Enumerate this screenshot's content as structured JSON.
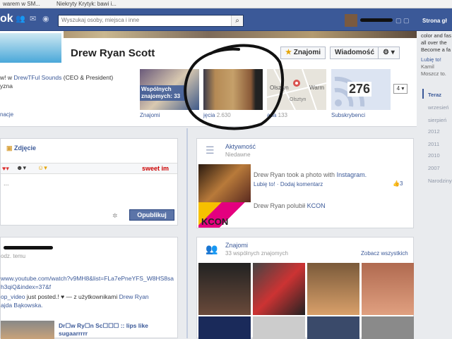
{
  "browser": {
    "tabs": [
      "warem w SM...",
      "Niekryty Krytyk: bawi i..."
    ]
  },
  "topbar": {
    "logo": "ok",
    "search_placeholder": "Wyszukaj osoby, miejsca i inne",
    "page_link": "Strona gł"
  },
  "profile": {
    "name": "Drew Ryan Scott",
    "btn_friends": "Znajomi",
    "btn_message": "Wiadomość",
    "btn_settings": "⚙ ▾",
    "info_line1_prefix": "w! w",
    "info_line1_link": "DrewTFul Sounds",
    "info_line1_suffix": "(CEO & President)",
    "info_line2": "yzna",
    "info_link": "nacje"
  },
  "tiles": {
    "common_friends": "Wspólnych znajomych: 33",
    "friends_label": "Znajomi",
    "photos_label": "jęcia",
    "photos_count": "2.630",
    "map_label": "apa",
    "map_count": "133",
    "map_city_left": "Olsztyn",
    "map_city_right": "Warm",
    "map_city_bottom": "Olsztyn",
    "subs_count": "276",
    "subs_label": "Subskrybenci",
    "more_count": "4"
  },
  "composer": {
    "photo_tab": "Zdjęcie",
    "placeholder": "...",
    "sweet": "sweet im",
    "publish": "Opublikuj"
  },
  "post": {
    "time": "odz. temu",
    "url": "www.youtube.com/watch?v9MH8&list=FLa7ePneYFS_W8HS8sah3qiQ&index=37&f",
    "body1": "op_video",
    "body2": "just posted.! ♥ — z użytkownikami",
    "tag1": "Drew Ryan",
    "tag2": "ajda Bąkowska.",
    "preview_title": "Dr☐w Ry☐n Sc☐☐☐ :: lips like sugaarrrrr"
  },
  "activity": {
    "title": "Aktywność",
    "subtitle": "Niedawne",
    "item1_prefix": "Drew Ryan took a photo with",
    "item1_link": "Instagram.",
    "like": "Lubię to!",
    "comment": "Dodaj komentarz",
    "likes": "3",
    "item2_prefix": "Drew Ryan polubił",
    "item2_link": "KCON",
    "kcon": "KCON"
  },
  "friends": {
    "title": "Znajomi",
    "subtitle": "33 wspólnych znajomych",
    "see_all": "Zobacz wszystkich"
  },
  "sidebar": {
    "ad_text": "color and fas all over the Become a fa",
    "ad_like": "Lubię to!",
    "ad_friend": "Kamil Moszcz to.",
    "current": "Teraz",
    "months": [
      "wrzesień",
      "sierpień"
    ],
    "years": [
      "2012",
      "2011",
      "2010",
      "2007"
    ],
    "born": "Narodziny"
  }
}
